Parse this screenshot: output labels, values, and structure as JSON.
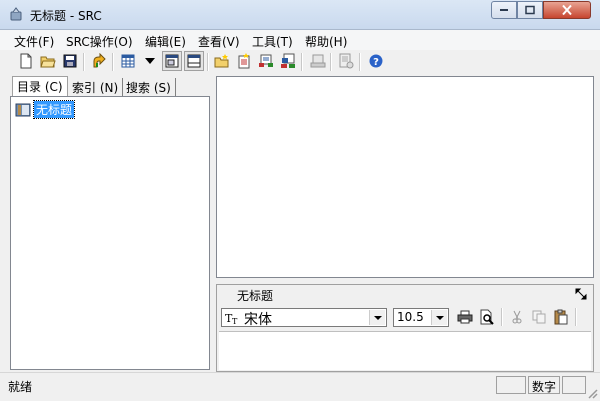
{
  "window": {
    "title": "无标题 - SRC"
  },
  "menu": {
    "items": [
      "文件(F)",
      "SRC操作(O)",
      "编辑(E)",
      "查看(V)",
      "工具(T)",
      "帮助(H)"
    ]
  },
  "toolbar": {
    "buttons": [
      {
        "icon": "new-file-icon"
      },
      {
        "icon": "open-folder-icon"
      },
      {
        "icon": "save-icon"
      },
      {
        "icon": "up-arrow-icon"
      },
      {
        "icon": "table-grid-icon"
      },
      {
        "icon": "dropdown-arrow-icon"
      },
      {
        "icon": "window-pane-icon"
      },
      {
        "icon": "window-split-icon"
      },
      {
        "icon": "folder-new-icon"
      },
      {
        "icon": "page-book-icon"
      },
      {
        "icon": "network-page-icon"
      },
      {
        "icon": "network-add-icon"
      },
      {
        "icon": "network-disabled-icon"
      },
      {
        "icon": "src-disabled-icon"
      },
      {
        "icon": "help-icon"
      }
    ]
  },
  "left_pane": {
    "tabs": [
      "目录 (C)",
      "索引 (N)",
      "搜索 (S)"
    ],
    "active_tab": "目录 (C)",
    "tree_items": [
      "无标题"
    ]
  },
  "bottom_panel": {
    "title": "无标题",
    "font_name": "宋体",
    "font_size": "10.5"
  },
  "statusbar": {
    "text": "就绪",
    "num_indicator": "数字"
  },
  "colors": {
    "selection": "#3399ff",
    "title_bar": "#c9d9ee"
  }
}
